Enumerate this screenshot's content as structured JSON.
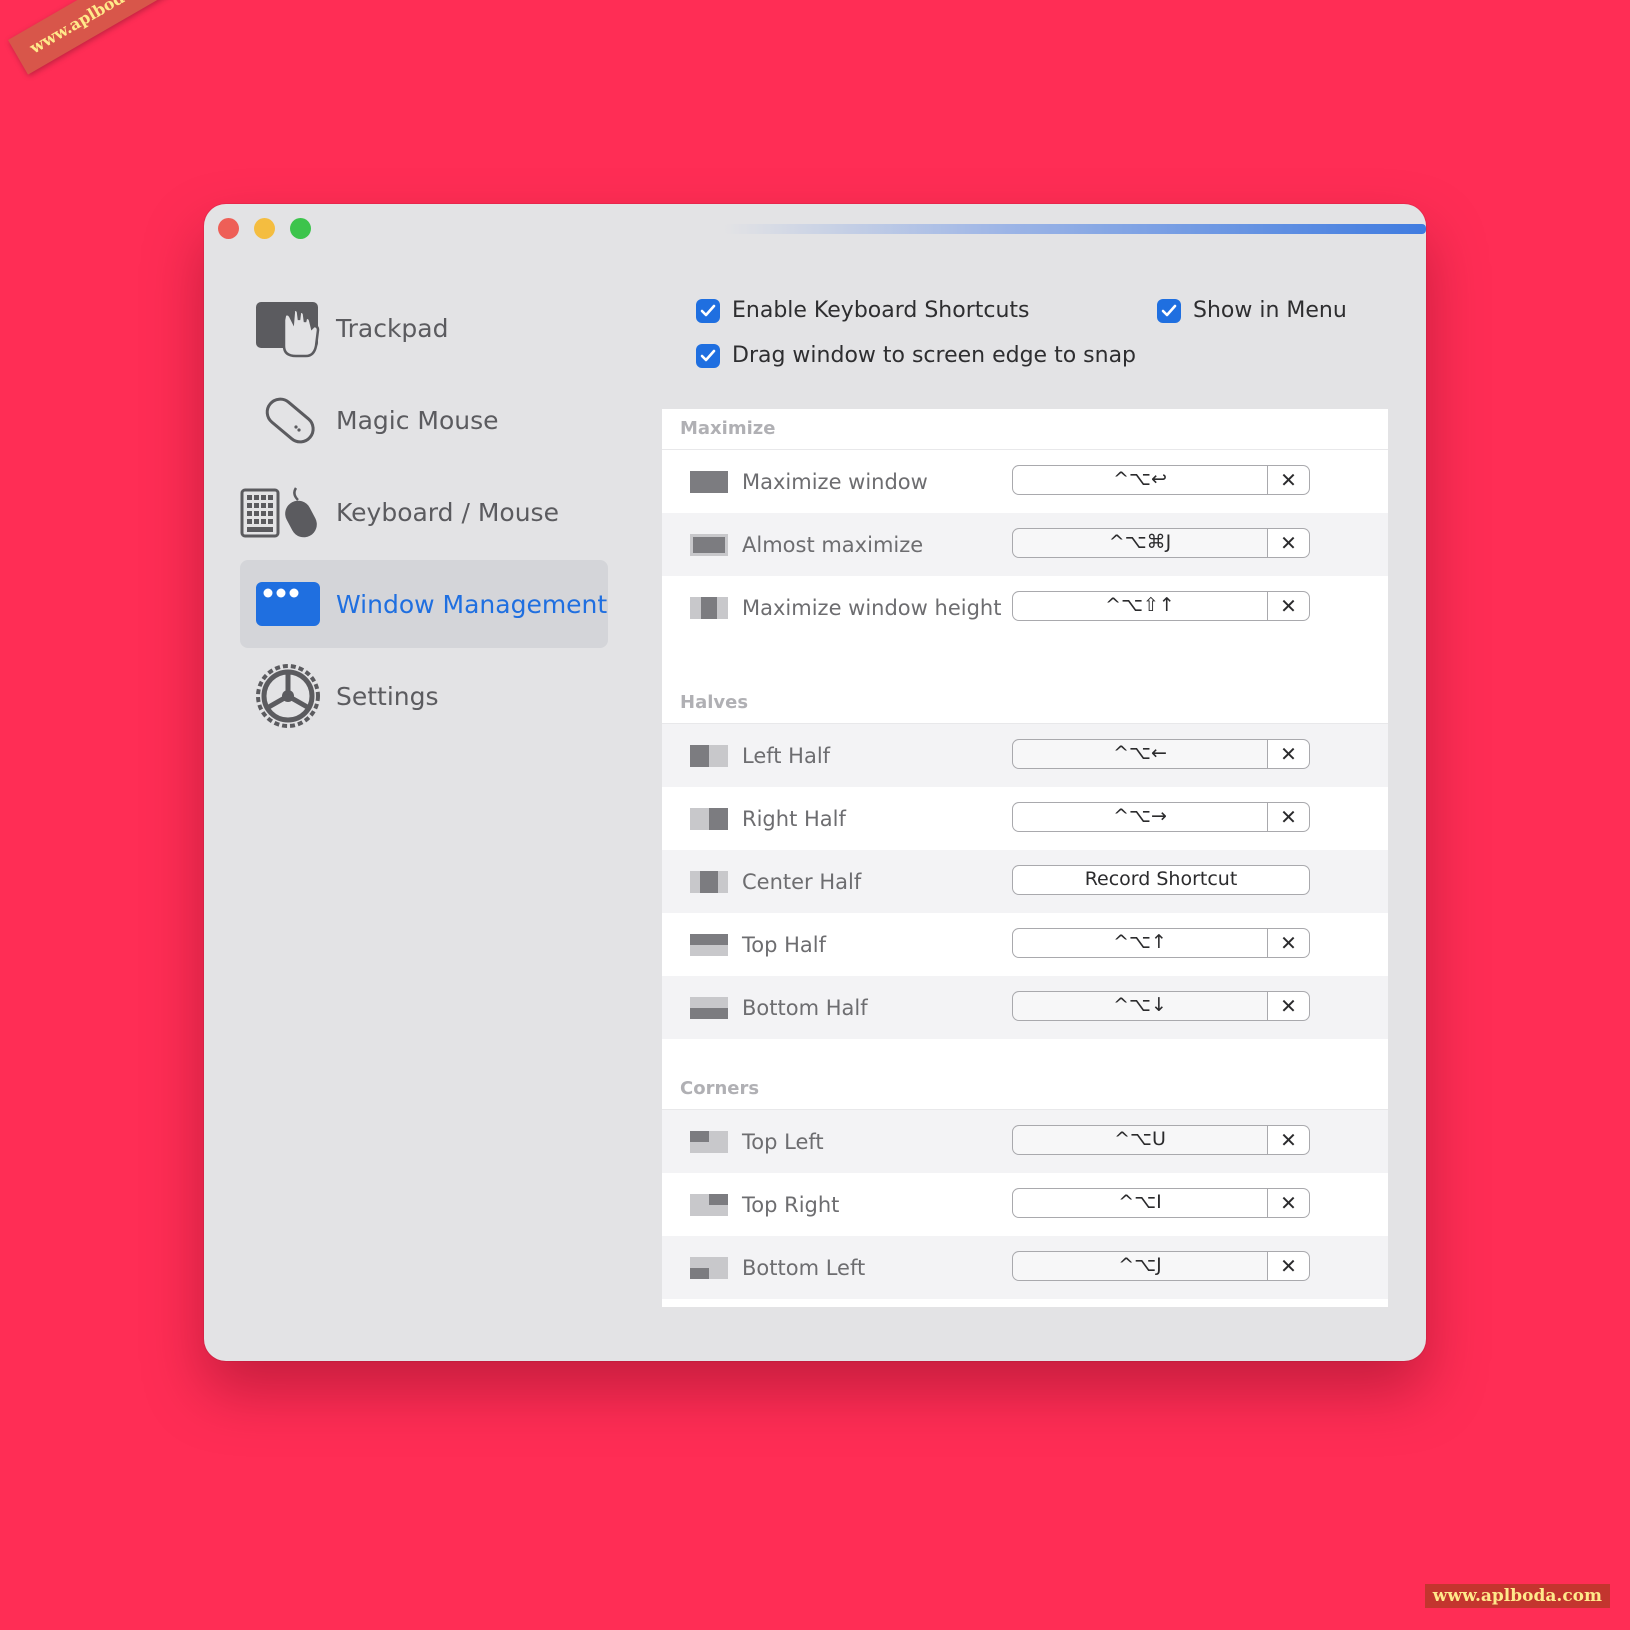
{
  "watermarks": {
    "top_left": "www.aplboda.com",
    "bottom_right": "www.aplboda.com"
  },
  "colors": {
    "background": "#ff2d55",
    "accent": "#1f6fe0",
    "window": "#e3e3e5"
  },
  "sidebar": {
    "items": [
      {
        "label": "Trackpad",
        "icon": "trackpad-hand-icon",
        "active": false
      },
      {
        "label": "Magic Mouse",
        "icon": "magic-mouse-icon",
        "active": false
      },
      {
        "label": "Keyboard / Mouse",
        "icon": "keyboard-mouse-icon",
        "active": false
      },
      {
        "label": "Window Management",
        "icon": "window-management-icon",
        "active": true
      },
      {
        "label": "Settings",
        "icon": "gear-icon",
        "active": false
      }
    ]
  },
  "options": {
    "enable_shortcuts": {
      "label": "Enable Keyboard Shortcuts",
      "checked": true
    },
    "show_in_menu": {
      "label": "Show in Menu",
      "checked": true
    },
    "drag_snap": {
      "label": "Drag window to screen edge to snap",
      "checked": true
    }
  },
  "sections": [
    {
      "title": "Maximize",
      "rows": [
        {
          "label": "Maximize window",
          "shortcut": "^⌥↩",
          "icon": "maximize-icon"
        },
        {
          "label": "Almost maximize",
          "shortcut": "^⌥⌘J",
          "icon": "almost-maximize-icon"
        },
        {
          "label": "Maximize window height",
          "shortcut": "^⌥⇧↑",
          "icon": "maximize-height-icon"
        }
      ]
    },
    {
      "title": "Halves",
      "rows": [
        {
          "label": "Left Half",
          "shortcut": "^⌥←",
          "icon": "left-half-icon"
        },
        {
          "label": "Right Half",
          "shortcut": "^⌥→",
          "icon": "right-half-icon"
        },
        {
          "label": "Center Half",
          "shortcut": "",
          "record_label": "Record Shortcut",
          "icon": "center-half-icon"
        },
        {
          "label": "Top Half",
          "shortcut": "^⌥↑",
          "icon": "top-half-icon"
        },
        {
          "label": "Bottom Half",
          "shortcut": "^⌥↓",
          "icon": "bottom-half-icon"
        }
      ]
    },
    {
      "title": "Corners",
      "rows": [
        {
          "label": "Top Left",
          "shortcut": "^⌥U",
          "icon": "top-left-icon"
        },
        {
          "label": "Top Right",
          "shortcut": "^⌥I",
          "icon": "top-right-icon"
        },
        {
          "label": "Bottom Left",
          "shortcut": "^⌥J",
          "icon": "bottom-left-icon"
        }
      ]
    }
  ],
  "clear_glyph": "✕"
}
